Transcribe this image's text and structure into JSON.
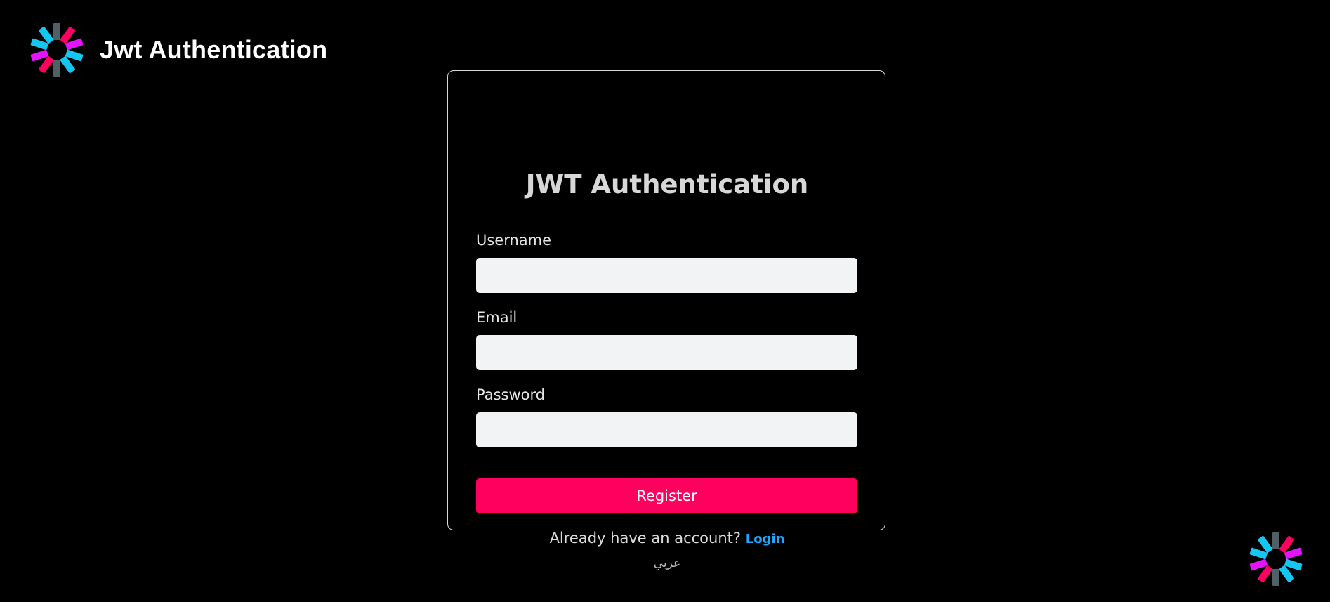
{
  "header": {
    "brand_title": "Jwt Authentication",
    "logo_icon": "jwt-logo-icon"
  },
  "form": {
    "title": "JWT Authentication",
    "username_label": "Username",
    "username_value": "",
    "email_label": "Email",
    "email_value": "",
    "password_label": "Password",
    "password_value": "",
    "submit_label": "Register",
    "account_prompt": "Already have an account?",
    "login_link_label": "Login",
    "language_switch_label": "عربي"
  },
  "colors": {
    "background": "#000000",
    "card_border": "#d8d8d8",
    "input_background": "#f2f3f5",
    "primary_button": "#ff005f",
    "link": "#1fa8ff",
    "logo_cyan": "#13c7f2",
    "logo_magenta": "#e513ff",
    "logo_pink": "#ff0062",
    "logo_gray": "#516067"
  },
  "corner_badge": {
    "icon": "jwt-logo-icon"
  }
}
